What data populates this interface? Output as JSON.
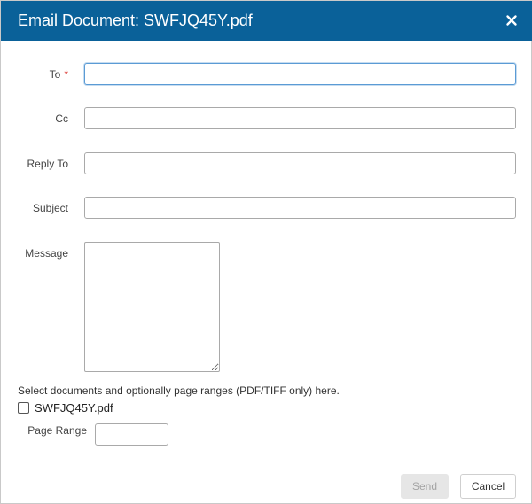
{
  "dialog": {
    "title": "Email Document: SWFJQ45Y.pdf",
    "close_icon": "close-icon",
    "header_color": "#0a6199",
    "required_color": "#d9312b"
  },
  "form": {
    "to": {
      "label": "To",
      "required_marker": "*",
      "value": ""
    },
    "cc": {
      "label": "Cc",
      "value": ""
    },
    "reply_to": {
      "label": "Reply To",
      "value": ""
    },
    "subject": {
      "label": "Subject",
      "value": ""
    },
    "message": {
      "label": "Message",
      "value": ""
    }
  },
  "documents": {
    "instructions": "Select documents and optionally page ranges (PDF/TIFF only) here.",
    "items": [
      {
        "filename": "SWFJQ45Y.pdf",
        "checked": false
      }
    ],
    "page_range_label": "Page Range",
    "page_range_value": ""
  },
  "buttons": {
    "send_label": "Send",
    "send_disabled": true,
    "cancel_label": "Cancel"
  }
}
